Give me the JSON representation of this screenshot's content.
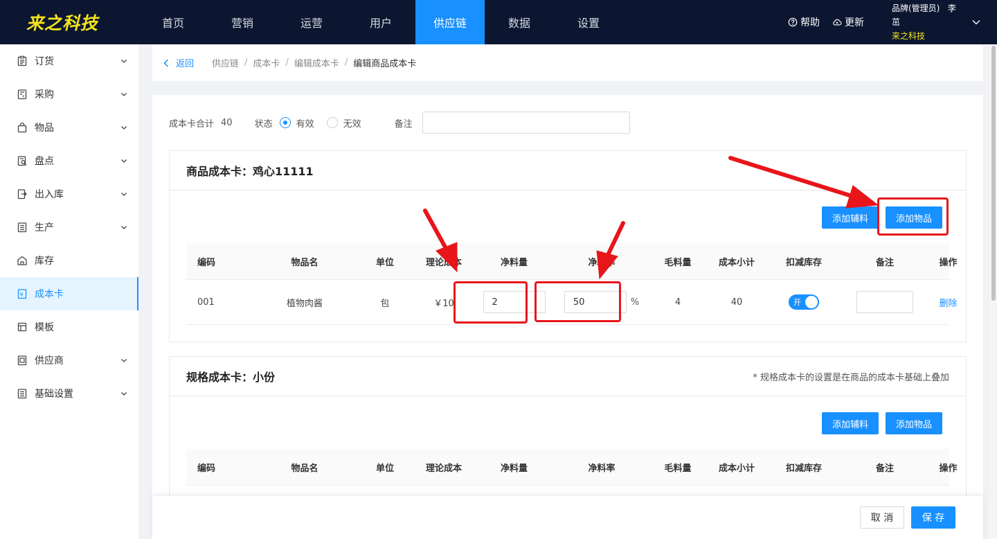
{
  "app": {
    "logo": "来之科技",
    "brand_color": "#1890ff",
    "logo_color": "#f5e51c"
  },
  "topnav": {
    "items": [
      "首页",
      "营销",
      "运营",
      "用户",
      "供应链",
      "数据",
      "设置"
    ],
    "active": "供应链",
    "help": "帮助",
    "update": "更新",
    "user_role": "品牌(管理员)",
    "user_name": "李茁",
    "brand_name": "来之科技"
  },
  "sidebar": {
    "items": [
      {
        "label": "订货",
        "icon": "clipboard-icon",
        "expandable": true
      },
      {
        "label": "采购",
        "icon": "purchase-icon",
        "expandable": true
      },
      {
        "label": "物品",
        "icon": "bag-icon",
        "expandable": true
      },
      {
        "label": "盘点",
        "icon": "inventory-check-icon",
        "expandable": true
      },
      {
        "label": "出入库",
        "icon": "in-out-icon",
        "expandable": true
      },
      {
        "label": "生产",
        "icon": "production-icon",
        "expandable": true
      },
      {
        "label": "库存",
        "icon": "warehouse-icon",
        "expandable": false
      },
      {
        "label": "成本卡",
        "icon": "cost-card-icon",
        "expandable": false,
        "active": true
      },
      {
        "label": "模板",
        "icon": "template-icon",
        "expandable": false
      },
      {
        "label": "供应商",
        "icon": "supplier-icon",
        "expandable": true
      },
      {
        "label": "基础设置",
        "icon": "settings-list-icon",
        "expandable": true
      }
    ]
  },
  "breadcrumb": {
    "back": "返回",
    "items": [
      "供应链",
      "成本卡",
      "编辑成本卡"
    ],
    "current": "编辑商品成本卡"
  },
  "filters": {
    "total_label": "成本卡合计",
    "total_value": "40",
    "status_label": "状态",
    "status_valid": "有效",
    "status_invalid": "无效",
    "status_selected": "有效",
    "remark_label": "备注",
    "remark_value": ""
  },
  "product_card": {
    "title": "商品成本卡：鸡心11111",
    "add_aux_btn": "添加辅料",
    "add_item_btn": "添加物品",
    "columns": [
      "编码",
      "物品名",
      "单位",
      "理论成本",
      "净料量",
      "净料率",
      "毛料量",
      "成本小计",
      "扣减库存",
      "备注",
      "操作"
    ],
    "rows": [
      {
        "code": "001",
        "name": "植物肉酱",
        "unit": "包",
        "theory_cost": "￥10",
        "net_qty": "2",
        "net_rate": "50",
        "rate_unit": "%",
        "gross_qty": "4",
        "subtotal": "40",
        "deduct_toggle": "开",
        "remark": "",
        "action": "删除"
      }
    ]
  },
  "spec_card": {
    "title": "规格成本卡：小份",
    "note": "* 规格成本卡的设置是在商品的成本卡基础上叠加",
    "add_aux_btn": "添加辅料",
    "add_item_btn": "添加物品",
    "columns": [
      "编码",
      "物品名",
      "单位",
      "理论成本",
      "净料量",
      "净料率",
      "毛料量",
      "成本小计",
      "扣减库存",
      "备注",
      "操作"
    ]
  },
  "footer": {
    "cancel": "取 消",
    "save": "保 存"
  },
  "annotation_color": "#e8151b"
}
